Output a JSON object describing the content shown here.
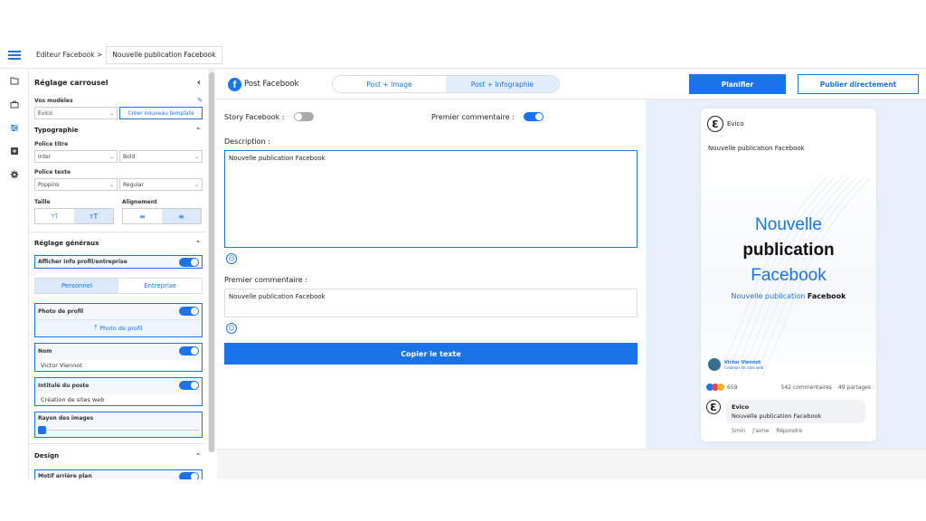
{
  "topbar": {
    "breadcrumb": "Editeur Facebook  >",
    "doc_title": "Nouvelle publication Facebook"
  },
  "sidebar": {
    "title": "Réglage carrousel",
    "models_label": "Vos modèles",
    "model_value": "Evico",
    "create_template": "Créer nouveau template",
    "typography_title": "Typographie",
    "title_font_label": "Police titre",
    "title_font": "Inter",
    "title_weight": "Bold",
    "text_font_label": "Police texte",
    "text_font": "Poppins",
    "text_weight": "Regular",
    "size_label": "Taille",
    "align_label": "Alignement",
    "general_title": "Réglage généraux",
    "show_profile_label": "Afficher info profil/entreprise",
    "tab_personal": "Personnel",
    "tab_company": "Entreprise",
    "profile_photo_label": "Photo de profil",
    "profile_photo_button": "Photo de profil",
    "name_label": "Nom",
    "name_value": "Victor Viennot",
    "job_label": "Intitulé du poste",
    "job_value": "Création de sites web",
    "radius_label": "Rayon des images",
    "design_title": "Design",
    "bg_pattern_label": "Motif arrière plan"
  },
  "main": {
    "title": "Post Facebook",
    "tabs": [
      "Post + Image",
      "Post + Infographie"
    ],
    "schedule_button": "Planifier",
    "publish_button": "Publier directement",
    "story_label": "Story Facebook :",
    "first_comment_toggle_label": "Premier commentaire :",
    "description_label": "Description :",
    "description_value": "Nouvelle publication Facebook",
    "first_comment_label": "Premier commentaire :",
    "first_comment_value": "Nouvelle publication Facebook",
    "copy_button": "Copier le texte"
  },
  "preview": {
    "page_name": "Evico",
    "post_text": "Nouvelle publication Facebook",
    "headline_1": "Nouvelle",
    "headline_2": "publication",
    "headline_3": "Facebook",
    "subline_blue": "Nouvelle publication",
    "subline_bold": "Facebook",
    "author_name": "Victor Viennot",
    "author_job": "Création de sites web",
    "reactions_count": "659",
    "comments_count": "542 commentaires",
    "shares_count": "49 partages",
    "comment_author": "Evico",
    "comment_text": "Nouvelle publication Facebook",
    "comment_time": "5min",
    "comment_like": "J'aime",
    "comment_reply": "Répondre"
  },
  "colors": {
    "accent": "#1a73e8",
    "preview_bg": "#e7f0fb"
  }
}
